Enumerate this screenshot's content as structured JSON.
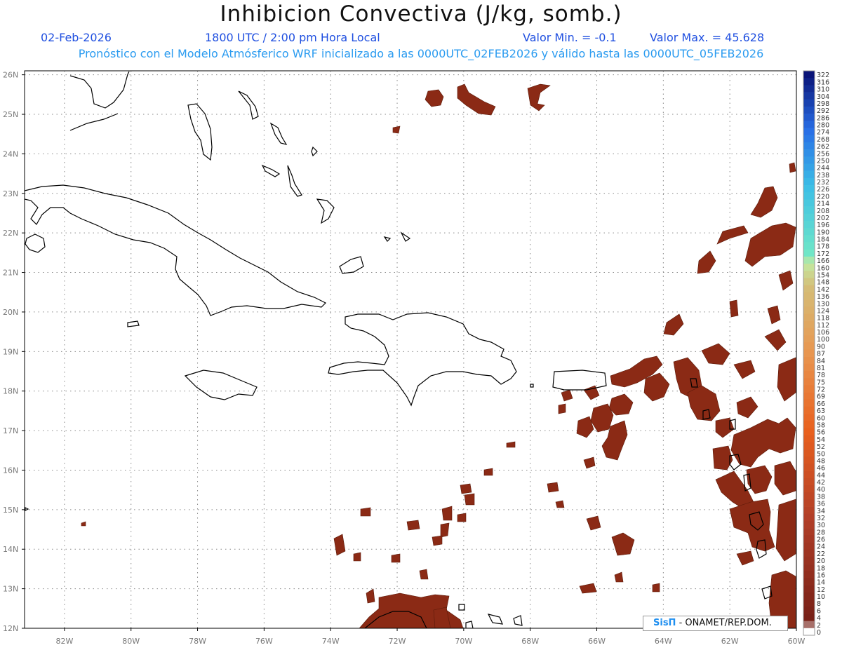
{
  "title": "Inhibicion Convectiva (J/kg, somb.)",
  "header": {
    "date": "02-Feb-2026",
    "time": "1800 UTC / 2:00 pm Hora Local",
    "valor_min_label": "Valor Min. = -0.1",
    "valor_max_label": "Valor Max. = 45.628",
    "subtitle": "Pronóstico con el Modelo Atmósferico WRF inicializado a las 0000UTC_02FEB2026 y válido hasta las  0000UTC_05FEB2026"
  },
  "map": {
    "lat_labels": [
      "26N",
      "25N",
      "24N",
      "23N",
      "22N",
      "21N",
      "20N",
      "19N",
      "18N",
      "17N",
      "16N",
      "15N",
      "14N",
      "13N",
      "12N"
    ],
    "lon_labels": [
      "82W",
      "80W",
      "78W",
      "76W",
      "74W",
      "72W",
      "70W",
      "68W",
      "66W",
      "64W",
      "62W",
      "60W"
    ],
    "lon_range": [
      -83.2,
      -60
    ],
    "lat_range": [
      12,
      26.1
    ],
    "field_color": "#8b2a15",
    "coast_color": "#000000",
    "grid_color": "#888888"
  },
  "colorbar": {
    "labels": [
      "322",
      "316",
      "310",
      "304",
      "298",
      "292",
      "286",
      "280",
      "274",
      "268",
      "262",
      "256",
      "250",
      "244",
      "238",
      "232",
      "226",
      "220",
      "214",
      "208",
      "202",
      "196",
      "190",
      "184",
      "178",
      "172",
      "166",
      "160",
      "154",
      "148",
      "142",
      "136",
      "130",
      "124",
      "118",
      "112",
      "106",
      "100",
      "90",
      "87",
      "84",
      "81",
      "78",
      "75",
      "72",
      "69",
      "66",
      "63",
      "60",
      "58",
      "56",
      "54",
      "52",
      "50",
      "48",
      "46",
      "44",
      "42",
      "40",
      "38",
      "36",
      "34",
      "32",
      "30",
      "28",
      "26",
      "24",
      "22",
      "20",
      "18",
      "16",
      "14",
      "12",
      "10",
      "8",
      "6",
      "4",
      "2",
      "0"
    ]
  },
  "credit": {
    "brand": "SisΠ",
    "text": "- ONAMET/REP.DOM."
  }
}
